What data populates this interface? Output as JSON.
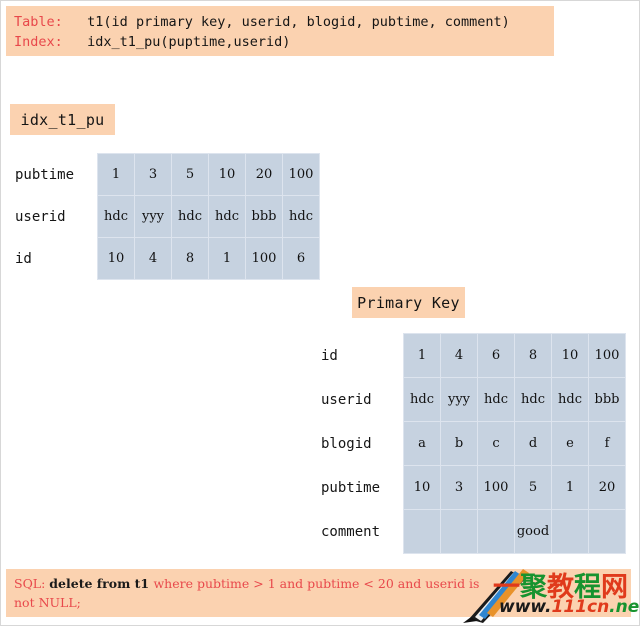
{
  "schema": {
    "table_key": "Table:",
    "table_def": "t1(id primary key, userid, blogid, pubtime, comment)",
    "index_key": "Index:",
    "index_def": "idx_t1_pu(puptime,userid)"
  },
  "index_section": {
    "chip_label": "idx_t1_pu",
    "row_labels": [
      "pubtime",
      "userid",
      "id"
    ],
    "rows": [
      [
        "1",
        "3",
        "5",
        "10",
        "20",
        "100"
      ],
      [
        "hdc",
        "yyy",
        "hdc",
        "hdc",
        "bbb",
        "hdc"
      ],
      [
        "10",
        "4",
        "8",
        "1",
        "100",
        "6"
      ]
    ]
  },
  "primary_key_section": {
    "chip_label": "Primary Key",
    "row_labels": [
      "id",
      "userid",
      "blogid",
      "pubtime",
      "comment"
    ],
    "rows": [
      [
        "1",
        "4",
        "6",
        "8",
        "10",
        "100"
      ],
      [
        "hdc",
        "yyy",
        "hdc",
        "hdc",
        "hdc",
        "bbb"
      ],
      [
        "a",
        "b",
        "c",
        "d",
        "e",
        "f"
      ],
      [
        "10",
        "3",
        "100",
        "5",
        "1",
        "20"
      ],
      [
        "",
        "",
        "",
        "good",
        "",
        ""
      ]
    ]
  },
  "sql_section": {
    "prefix": "SQL: ",
    "statement_dark": "delete from t1 ",
    "statement_red_line1": "where pubtime > 1 and pubtime < 20 and userid is",
    "statement_red_line2": "not NULL;"
  },
  "watermark": {
    "chinese": "一聚教程网",
    "url_w": "www.",
    "url_d": "111cn",
    "url_n": ".net"
  },
  "colors": {
    "chip_background": "#fbd2b0",
    "cell_background": "#c6d2e0",
    "cell_border": "#dde4ee",
    "accent_red": "#e8484b",
    "page_border": "#d7d7d7"
  }
}
